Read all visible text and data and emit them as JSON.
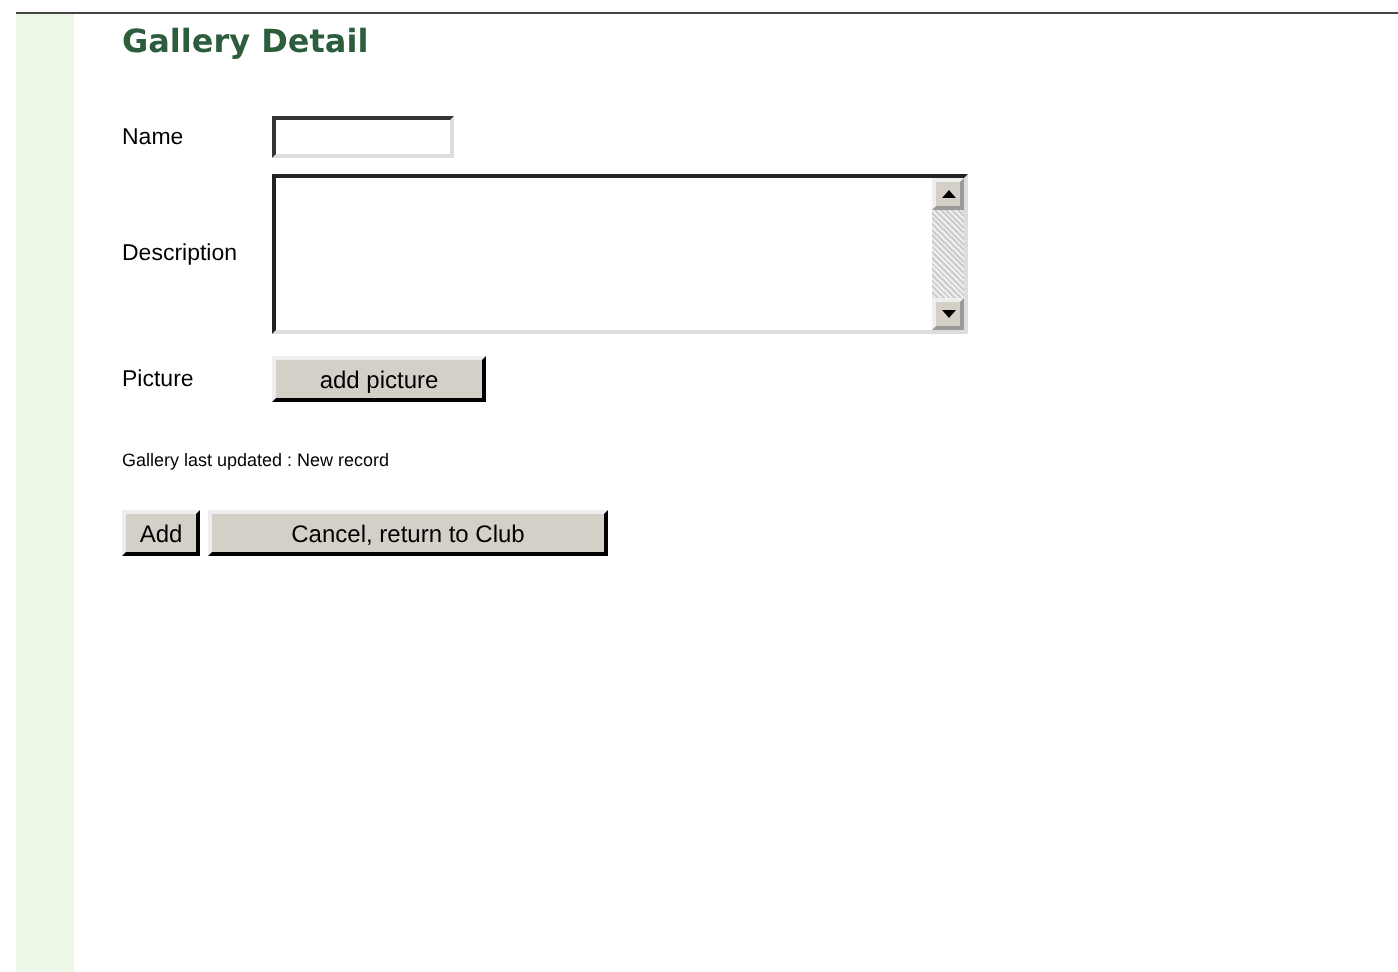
{
  "title": "Gallery Detail",
  "form": {
    "name": {
      "label": "Name"
    },
    "description": {
      "label": "Description"
    },
    "picture": {
      "label": "Picture",
      "button": "add picture"
    }
  },
  "status": "Gallery last updated : New record",
  "buttons": [
    "Add",
    "Cancel, return to Club"
  ]
}
